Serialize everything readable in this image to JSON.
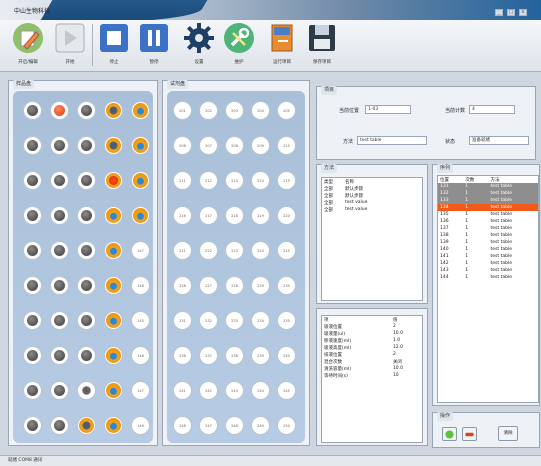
{
  "window": {
    "title": "中山生物科技",
    "btn_min": "_",
    "btn_max": "□",
    "btn_close": "x"
  },
  "toolbar": {
    "items": [
      {
        "label": "开启/编辑",
        "icon": "pencil-edit-icon"
      },
      {
        "label": "开始",
        "icon": "play-icon"
      },
      {
        "label": "停止",
        "icon": "stop-icon"
      },
      {
        "label": "暂停",
        "icon": "pause-icon"
      },
      {
        "label": "设置",
        "icon": "gear-icon"
      },
      {
        "label": "维护",
        "icon": "wrench-screwdriver-icon"
      },
      {
        "label": "运行项目",
        "icon": "book-icon"
      },
      {
        "label": "保存项目",
        "icon": "floppy-disk-icon"
      }
    ]
  },
  "sample_panel": {
    "title": "样品盘"
  },
  "sample_wells": [
    [
      "dark",
      "red",
      "dark",
      "gold",
      "goldbl"
    ],
    [
      "dark",
      "dark",
      "dark",
      "gold",
      "goldbl"
    ],
    [
      "dark",
      "dark",
      "dark",
      "goldred",
      "goldbl"
    ],
    [
      "dark",
      "dark",
      "dark",
      "goldbl",
      "goldbl"
    ],
    [
      "dark",
      "dark",
      "dark",
      "goldbl",
      "empty"
    ],
    [
      "dark",
      "dark",
      "dark",
      "goldbl",
      "empty"
    ],
    [
      "dark",
      "dark",
      "dark",
      "goldbl",
      "empty"
    ],
    [
      "dark",
      "dark",
      "dark",
      "goldbl",
      "empty"
    ],
    [
      "dark",
      "dark",
      "ring",
      "goldbl",
      "empty"
    ],
    [
      "dark",
      "dark",
      "gold",
      "goldbl",
      "empty"
    ]
  ],
  "sample_empty_labels": [
    "147",
    "148",
    "145",
    "146",
    "147",
    "149"
  ],
  "reagent_panel": {
    "title": "试剂盘"
  },
  "reagent_labels": [
    [
      "201",
      "202",
      "203",
      "204",
      "205"
    ],
    [
      "206",
      "207",
      "208",
      "209",
      "210"
    ],
    [
      "211",
      "212",
      "213",
      "214",
      "215"
    ],
    [
      "216",
      "217",
      "218",
      "219",
      "220"
    ],
    [
      "221",
      "222",
      "223",
      "224",
      "225"
    ],
    [
      "226",
      "227",
      "228",
      "229",
      "230"
    ],
    [
      "231",
      "232",
      "233",
      "234",
      "235"
    ],
    [
      "236",
      "237",
      "238",
      "239",
      "240"
    ],
    [
      "241",
      "242",
      "243",
      "244",
      "245"
    ],
    [
      "246",
      "247",
      "248",
      "249",
      "250"
    ]
  ],
  "info_panel": {
    "title": "项目",
    "field1_label": "当前位置",
    "field1_value": "1-03",
    "field2_label": "当前计数",
    "field2_value": "4",
    "field3_label": "方法",
    "field3_value": "test table",
    "field4_label": "状态",
    "field4_value": "准备就绪"
  },
  "mid_panel": {
    "title": "方法",
    "headers": [
      "类型",
      "名称"
    ],
    "rows": [
      [
        "全部",
        "默认步骤"
      ],
      [
        "全部",
        "默认步骤"
      ],
      [
        "全部",
        "test value"
      ],
      [
        "全部",
        "test value"
      ]
    ]
  },
  "param_panel": {
    "headers": [
      "项",
      "值"
    ],
    "rows": [
      [
        "吸液位置",
        "2"
      ],
      [
        "吸液量(ul)",
        "10.0"
      ],
      [
        "移液速度(ml)",
        "1.0"
      ],
      [
        "吸液高度(ml)",
        "12.0"
      ],
      [
        "排液位置",
        "2"
      ],
      [
        "混合次数",
        "关闭"
      ],
      [
        "清洗容量(ml)",
        "10.0"
      ],
      [
        "等待时间(s)",
        "10"
      ]
    ]
  },
  "right_panel": {
    "title": "序列",
    "headers": [
      "位置",
      "次数",
      "方法"
    ],
    "rows": [
      [
        "131",
        "1",
        "test table"
      ],
      [
        "132",
        "1",
        "test table"
      ],
      [
        "133",
        "1",
        "test table"
      ],
      [
        "134",
        "1",
        "test table"
      ],
      [
        "135",
        "1",
        "test table"
      ],
      [
        "136",
        "1",
        "test table"
      ],
      [
        "137",
        "1",
        "test table"
      ],
      [
        "138",
        "1",
        "test table"
      ],
      [
        "139",
        "1",
        "test table"
      ],
      [
        "140",
        "1",
        "test table"
      ],
      [
        "141",
        "1",
        "test table"
      ],
      [
        "142",
        "1",
        "test table"
      ],
      [
        "143",
        "1",
        "test table"
      ],
      [
        "144",
        "1",
        "test table"
      ]
    ],
    "highlight_gray": [
      0,
      1,
      2
    ],
    "highlight_orange": [
      3
    ]
  },
  "bottom_controls": {
    "title": "操作",
    "action_label": "清除"
  },
  "status_bar": {
    "text": "就绪 COM8 通讯"
  }
}
